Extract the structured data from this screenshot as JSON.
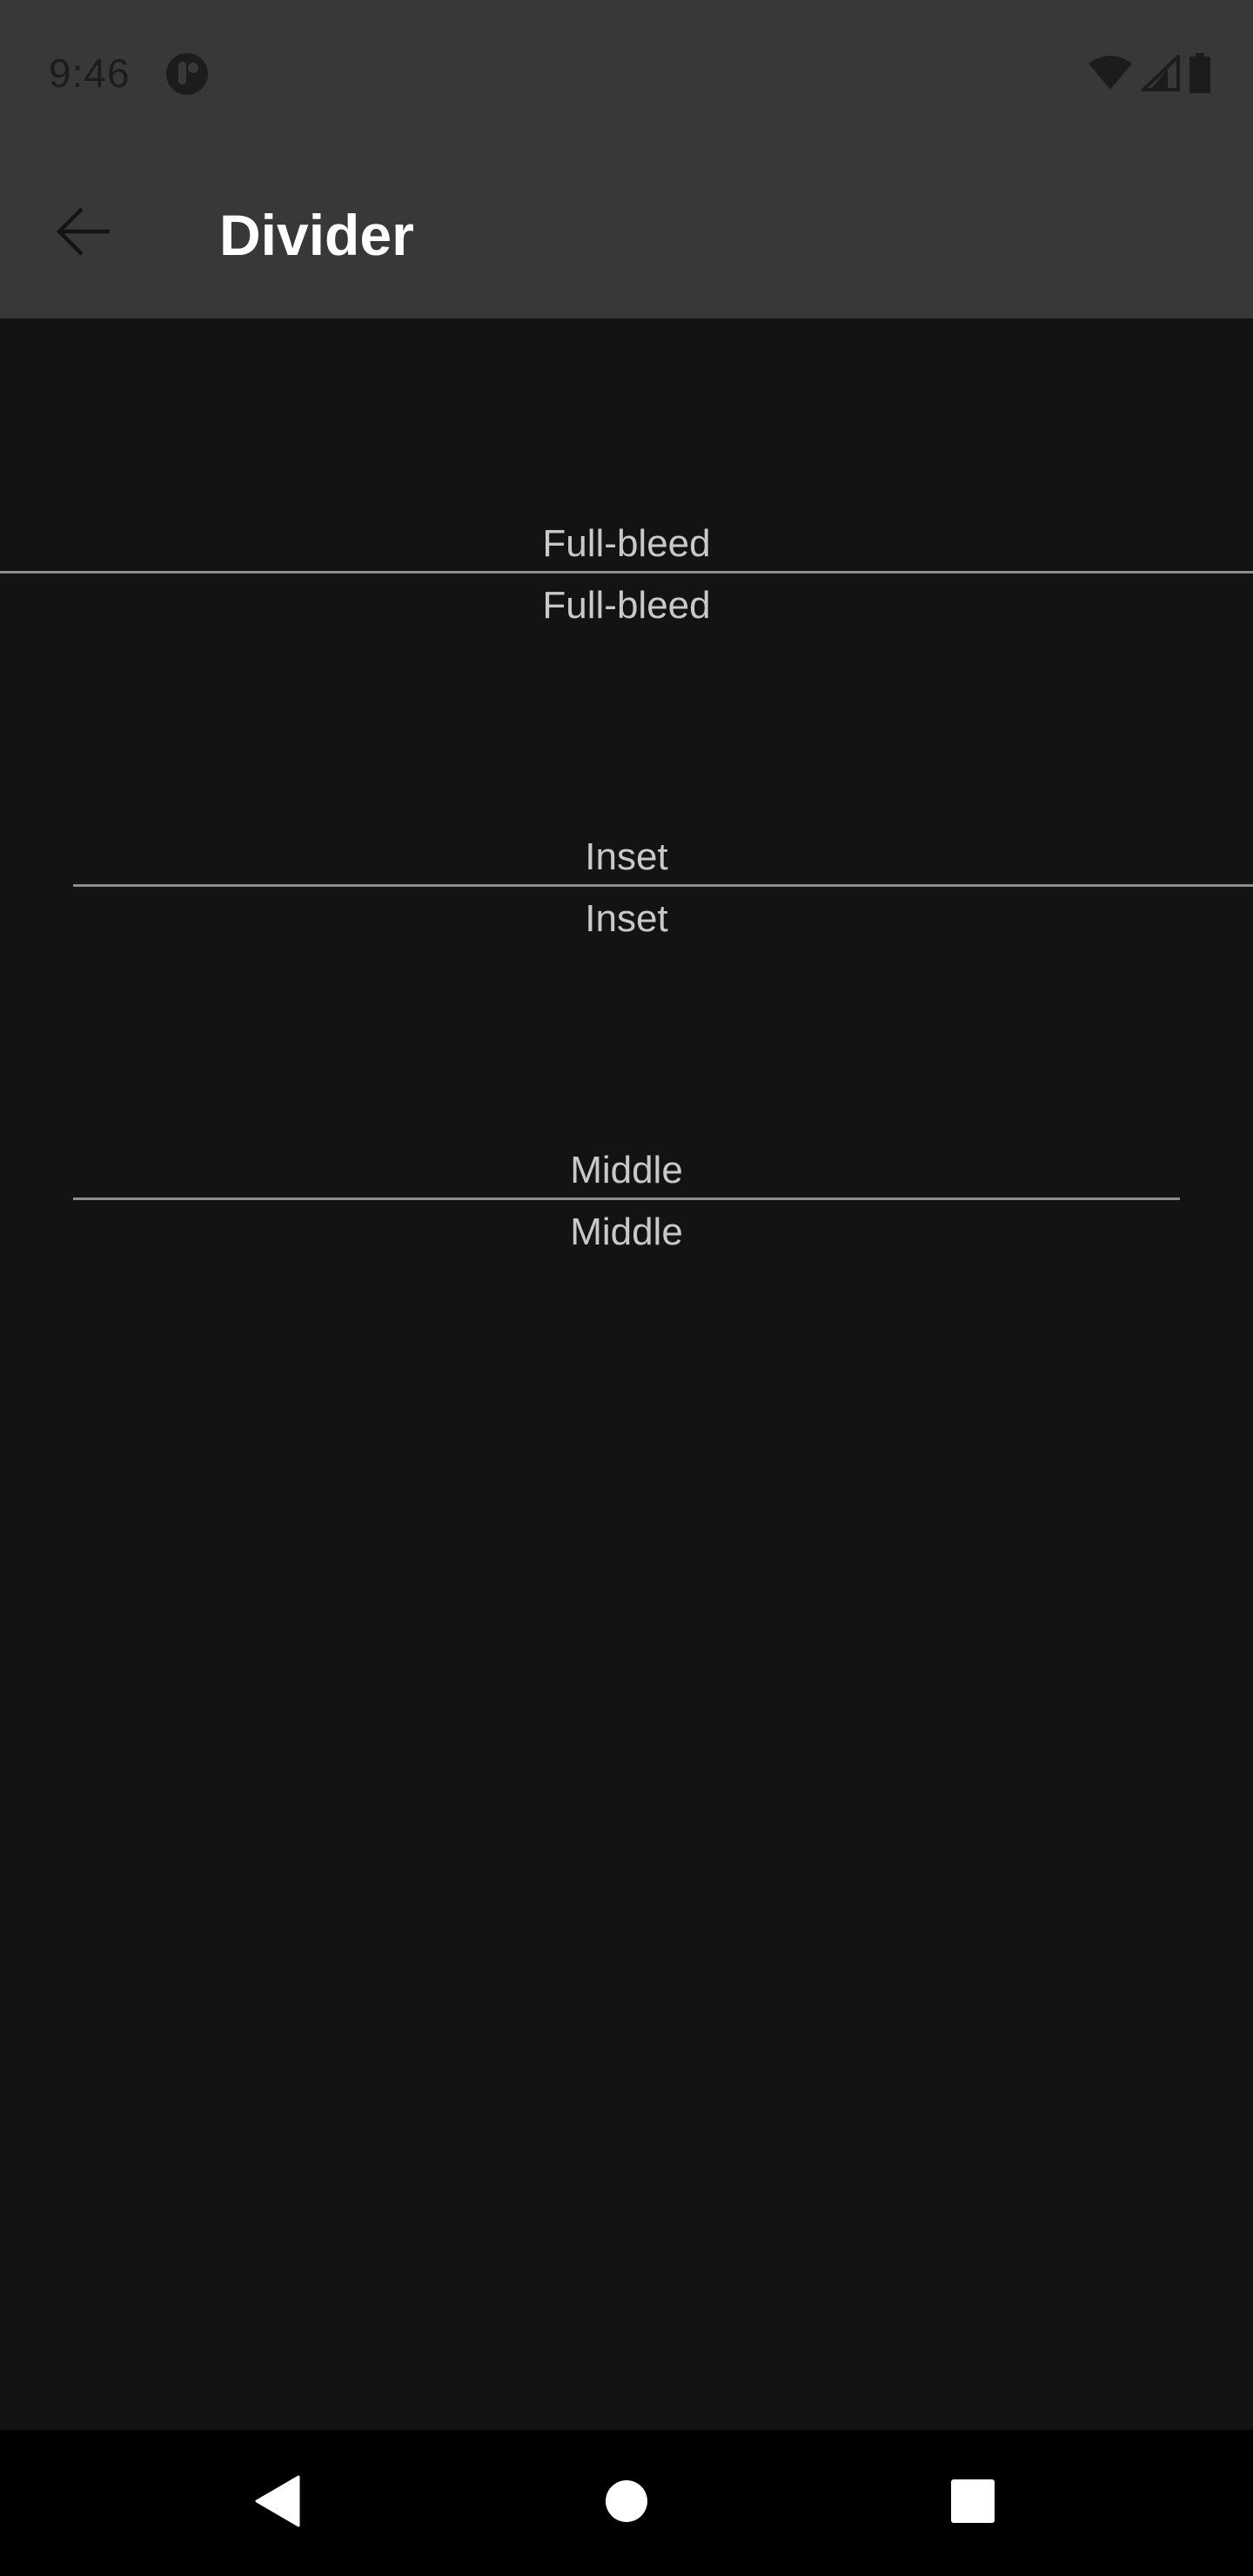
{
  "status_bar": {
    "time": "9:46",
    "app_icon": "notification-app-icon",
    "icons": [
      "wifi-icon",
      "cell-signal-icon",
      "battery-icon"
    ]
  },
  "app_bar": {
    "title": "Divider",
    "back_icon": "arrow-back-icon"
  },
  "sections": [
    {
      "name": "full-bleed",
      "label_above": "Full-bleed",
      "label_below": "Full-bleed"
    },
    {
      "name": "inset",
      "label_above": "Inset",
      "label_below": "Inset"
    },
    {
      "name": "middle",
      "label_above": "Middle",
      "label_below": "Middle"
    }
  ],
  "nav_bar": {
    "buttons": [
      "back-triangle-icon",
      "home-circle-icon",
      "recents-square-icon"
    ]
  },
  "colors": {
    "background": "#131313",
    "app_bar": "#383838",
    "divider": "#8e8e8e",
    "label_text": "#c9c9c9",
    "title_text": "#ffffff"
  }
}
